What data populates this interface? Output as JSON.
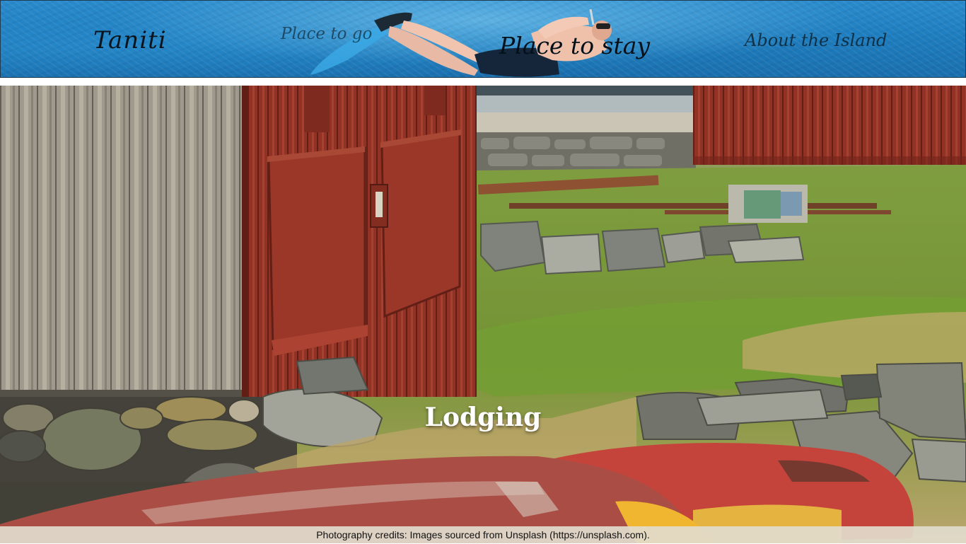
{
  "nav": {
    "brand": "Taniti",
    "items": [
      {
        "label": "Place to go"
      },
      {
        "label": "Place to stay"
      },
      {
        "label": "About the Island"
      }
    ]
  },
  "hero": {
    "title": "Lodging"
  },
  "footer": {
    "credits": "Photography credits: Images sourced from Unsplash (https://unsplash.com)."
  },
  "icons": {
    "banner_illustration": "snorkeler-illustration"
  },
  "colors": {
    "banner_blue": "#1f7ebf",
    "nav_text": "#0a1a26",
    "boathouse_red": "#8e2a1d",
    "credits_bg": "#e1dccd"
  }
}
